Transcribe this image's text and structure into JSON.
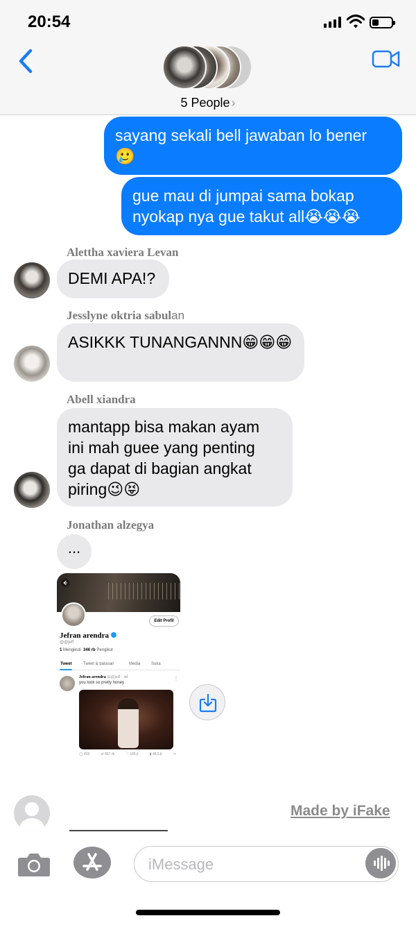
{
  "status_bar": {
    "time": "20:54"
  },
  "header": {
    "people_label": "5 People",
    "chevron": "›"
  },
  "messages": [
    {
      "text": "sayang sekali bell jawaban lo bener",
      "emoji": "🥲"
    },
    {
      "text": "gue mau di jumpai sama bokap nyokap nya gue takut all",
      "emoji": "😭😭😭"
    },
    {
      "sender_serif": "Alettha xaviera Levan",
      "sender_tail": "",
      "text": "DEMI APA!?"
    },
    {
      "sender_serif": "Jesslyne oktria sabul",
      "sender_tail": "an",
      "text": "ASIKKK TUNANGANNN",
      "emoji": "😁😁😁"
    },
    {
      "sender_serif": "Abell xiandra",
      "sender_tail": "",
      "text_lines": [
        "mantapp bisa makan ayam",
        "ini mah guee yang penting",
        "ga dapat di bagian angkat",
        "piring"
      ],
      "emoji": "😉😝"
    },
    {
      "sender_serif": "Jonathan alzegya",
      "sender_tail": "",
      "text": "..."
    }
  ],
  "shared_screenshot": {
    "edit_button": "Edit Profil",
    "display_name": "Jefran arendra",
    "handle": "@@jeff",
    "following_count": "1",
    "following_label": "Mengikuti",
    "followers_count": "346 rb",
    "followers_label": "Pengikut",
    "tabs": [
      "Tweet",
      "Tweet & balasan",
      "Media",
      "Suka"
    ],
    "tweet_author": "Jefran arendra",
    "tweet_meta": "@@jeff · 4d",
    "tweet_text": "you look so pretty honey",
    "tweet_actions": [
      "433",
      "657 rb",
      "165 jt",
      "46,5 jt"
    ]
  },
  "footer": {
    "made_by": "Made by iFake"
  },
  "composer": {
    "placeholder": "iMessage"
  },
  "colors": {
    "outgoing": "#0a7cff",
    "incoming": "#e9e9eb",
    "accent": "#1a7cf5"
  }
}
